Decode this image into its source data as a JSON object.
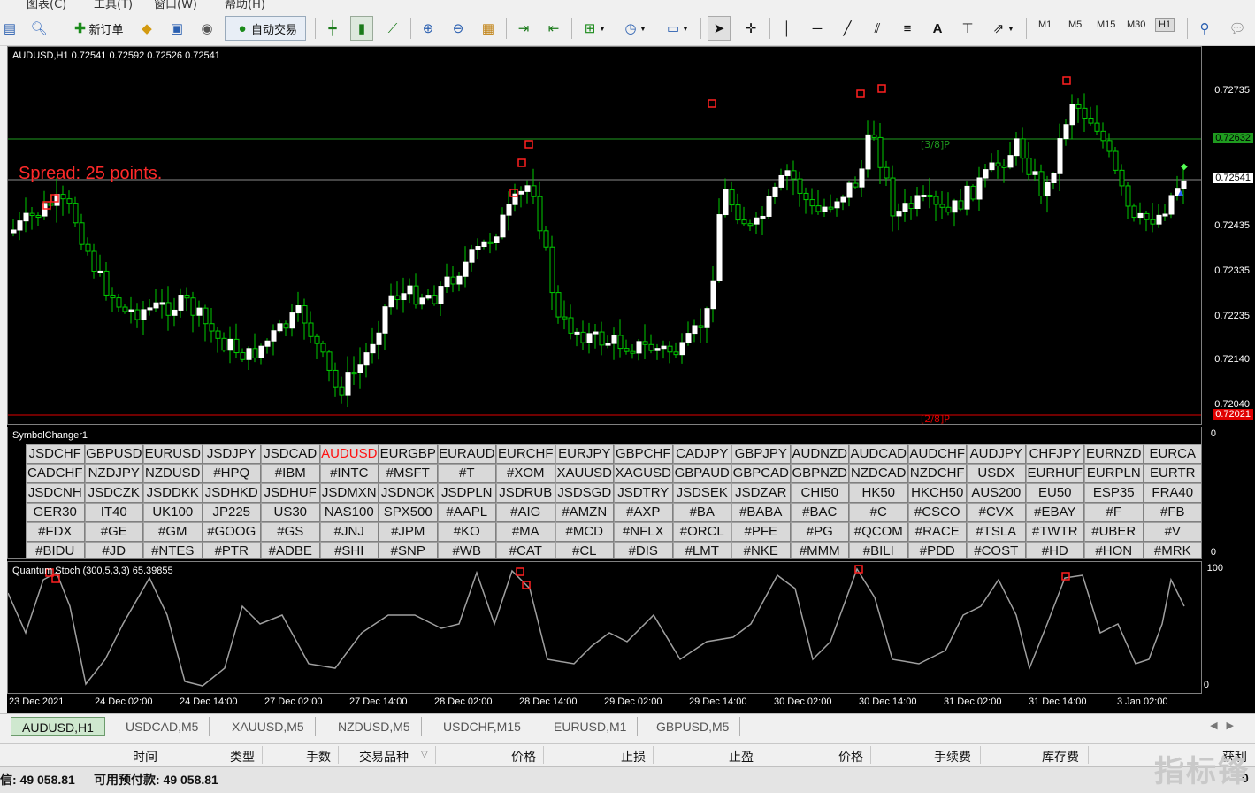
{
  "menu": [
    "图表(C)",
    "工具(T)",
    "窗口(W)",
    "帮助(H)"
  ],
  "toolbar": {
    "new_order_label": "新订单",
    "auto_trade_label": "自动交易",
    "timeframes": [
      "M1",
      "M5",
      "M15",
      "M30",
      "H1"
    ],
    "active_timeframe": "H1"
  },
  "chart": {
    "title": "AUDUSD,H1  0.72541 0.72592 0.72526 0.72541",
    "spread_text": "Spread: 25 points.",
    "pivot_upper": "[3/8]P",
    "pivot_lower": "[2/8]P",
    "price_labels": [
      "0.72735",
      "0.72632",
      "0.72541",
      "0.72435",
      "0.72335",
      "0.72235",
      "0.72140",
      "0.72040",
      "0.72021"
    ],
    "current_price": "0.72541",
    "upper_level": "0.72632",
    "lower_level": "0.72021"
  },
  "symbol_changer": {
    "title": "SymbolChanger1",
    "selected": "AUDUSD",
    "symbols": [
      "JSDCHF",
      "GBPUSD",
      "EURUSD",
      "JSDJPY",
      "JSDCAD",
      "AUDUSD",
      "EURGBP",
      "EURAUD",
      "EURCHF",
      "EURJPY",
      "GBPCHF",
      "CADJPY",
      "GBPJPY",
      "AUDNZD",
      "AUDCAD",
      "AUDCHF",
      "AUDJPY",
      "CHFJPY",
      "EURNZD",
      "EURCA",
      "CADCHF",
      "NZDJPY",
      "NZDUSD",
      "#HPQ",
      "#IBM",
      "#INTC",
      "#MSFT",
      "#T",
      "#XOM",
      "XAUUSD",
      "XAGUSD",
      "GBPAUD",
      "GBPCAD",
      "GBPNZD",
      "NZDCAD",
      "NZDCHF",
      "USDX",
      "EURHUF",
      "EURPLN",
      "EURTR",
      "JSDCNH",
      "JSDCZK",
      "JSDDKK",
      "JSDHKD",
      "JSDHUF",
      "JSDMXN",
      "JSDNOK",
      "JSDPLN",
      "JSDRUB",
      "JSDSGD",
      "JSDTRY",
      "JSDSEK",
      "JSDZAR",
      "CHI50",
      "HK50",
      "HKCH50",
      "AUS200",
      "EU50",
      "ESP35",
      "FRA40",
      "GER30",
      "IT40",
      "UK100",
      "JP225",
      "US30",
      "NAS100",
      "SPX500",
      "#AAPL",
      "#AIG",
      "#AMZN",
      "#AXP",
      "#BA",
      "#BABA",
      "#BAC",
      "#C",
      "#CSCO",
      "#CVX",
      "#EBAY",
      "#F",
      "#FB",
      "#FDX",
      "#GE",
      "#GM",
      "#GOOG",
      "#GS",
      "#JNJ",
      "#JPM",
      "#KO",
      "#MA",
      "#MCD",
      "#NFLX",
      "#ORCL",
      "#PFE",
      "#PG",
      "#QCOM",
      "#RACE",
      "#TSLA",
      "#TWTR",
      "#UBER",
      "#V",
      "#BIDU",
      "#JD",
      "#NTES",
      "#PTR",
      "#ADBE",
      "#SHI",
      "#SNP",
      "#WB",
      "#CAT",
      "#CL",
      "#DIS",
      "#LMT",
      "#NKE",
      "#MMM",
      "#BILI",
      "#PDD",
      "#COST",
      "#HD",
      "#HON",
      "#MRK"
    ],
    "axis_top": "0",
    "axis_bottom": "0"
  },
  "oscillator": {
    "title": "Quantum Stoch (300,5,3,3) 65.39855",
    "axis_top": "100",
    "axis_bottom": "0"
  },
  "x_axis": [
    "23 Dec 2021",
    "24 Dec 02:00",
    "24 Dec 14:00",
    "27 Dec 02:00",
    "27 Dec 14:00",
    "28 Dec 02:00",
    "28 Dec 14:00",
    "29 Dec 02:00",
    "29 Dec 14:00",
    "30 Dec 02:00",
    "30 Dec 14:00",
    "31 Dec 02:00",
    "31 Dec 14:00",
    "3 Jan 02:00"
  ],
  "tabs": [
    "AUDUSD,H1",
    "USDCAD,M5",
    "XAUUSD,M5",
    "NZDUSD,M5",
    "USDCHF,M15",
    "EURUSD,M1",
    "GBPUSD,M5"
  ],
  "terminal_columns": [
    "时间",
    "类型",
    "手数",
    "交易品种",
    "价格",
    "止损",
    "止盈",
    "价格",
    "手续费",
    "库存费",
    "获利"
  ],
  "status": {
    "balance_text": "信: 49 058.81",
    "free_margin_text": "可用预付款: 49 058.81",
    "profit_value": "0"
  },
  "watermark": "指标锋",
  "colors": {
    "bull": "#ffffff",
    "bear": "#00cc00",
    "wick": "#00cc00",
    "level_green": "#1f9b1f",
    "level_red": "#e00000",
    "marker": "#ff2020",
    "osc_line": "#a0a0a0"
  }
}
